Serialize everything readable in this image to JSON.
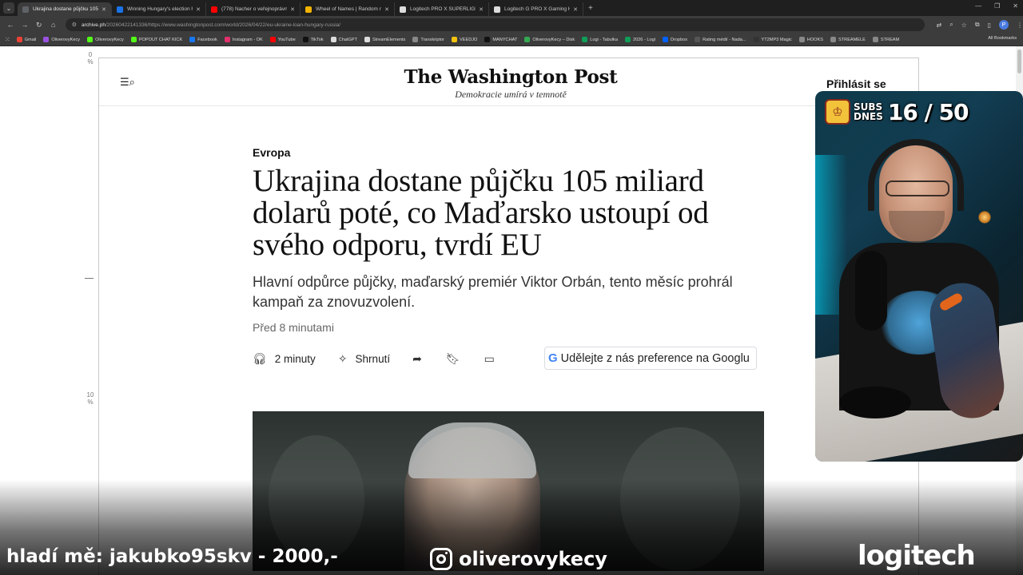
{
  "browser": {
    "tabs": [
      {
        "title": "Ukrajina dostane půjčku 105 mi",
        "color": "#5f6368",
        "active": true
      },
      {
        "title": "Winning Hungary's election ha",
        "color": "#1a73e8",
        "active": false
      },
      {
        "title": "(778) Nacher o veřejnoprávních",
        "color": "#ff0000",
        "active": false
      },
      {
        "title": "Wheel of Names | Random nam",
        "color": "#f4b400",
        "active": false
      },
      {
        "title": "Logitech PRO X SUPERLIGHT 2",
        "color": "#dddddd",
        "active": false
      },
      {
        "title": "Logitech G PRO X Gaming Hea",
        "color": "#dddddd",
        "active": false
      }
    ],
    "url_host": "archive.ph",
    "url_path": "/20260422141336/https://www.washingtonpost.com/world/2026/04/22/eu-ukraine-loan-hungary-russia/",
    "profile_initial": "P",
    "bookmarks": [
      {
        "label": "Gmail",
        "color": "#ea4335"
      },
      {
        "label": "OliverovyKecy",
        "color": "#9b51e0"
      },
      {
        "label": "OliverovyKecy",
        "color": "#53fc18"
      },
      {
        "label": "POPOUT CHAT KICK",
        "color": "#53fc18"
      },
      {
        "label": "Facebook",
        "color": "#1877f2"
      },
      {
        "label": "Instagram - OK",
        "color": "#e1306c"
      },
      {
        "label": "YouTube",
        "color": "#ff0000"
      },
      {
        "label": "TikTok",
        "color": "#111111"
      },
      {
        "label": "ChatGPT",
        "color": "#dddddd"
      },
      {
        "label": "StreamElements",
        "color": "#dddddd"
      },
      {
        "label": "Transkriptor",
        "color": "#888888"
      },
      {
        "label": "VEEDJO",
        "color": "#f4c20d"
      },
      {
        "label": "MANYCHAT",
        "color": "#111111"
      },
      {
        "label": "OliverovyKecy – Disk",
        "color": "#34a853"
      },
      {
        "label": "Logi - Tabulka",
        "color": "#0f9d58"
      },
      {
        "label": "2026 - Logi",
        "color": "#0f9d58"
      },
      {
        "label": "Dropbox",
        "color": "#0061ff"
      },
      {
        "label": "Rating médií - Nada...",
        "color": "#555555"
      },
      {
        "label": "YT2MP3 Magic",
        "color": "#333333"
      },
      {
        "label": "HOOKS",
        "color": "#888888"
      },
      {
        "label": "STREAMELE",
        "color": "#888888"
      },
      {
        "label": "STREAM",
        "color": "#888888"
      }
    ],
    "all_bookmarks": "All Bookmarks"
  },
  "ruler": {
    "top": "0 %",
    "bottom": "10 %"
  },
  "site": {
    "logo": "The Washington Post",
    "tagline": "Demokracie umírá v temnotě",
    "signin": "Přihlásit se"
  },
  "article": {
    "section": "Evropa",
    "headline": "Ukrajina dostane půjčku 105 miliard dolarů poté, co Maďarsko ustoupí od svého odporu, tvrdí EU",
    "dek": "Hlavní odpůrce půjčky, maďarský premiér Viktor Orbán, tento měsíc prohrál kampaň za znovuzvolení.",
    "timestamp": "Před 8 minutami",
    "listen_label": "2 minuty",
    "summary_label": "Shrnutí",
    "google_pref_label": "Udělejte z nás preference na Googlu"
  },
  "stream": {
    "subs_label_1": "SUBS",
    "subs_label_2": "DNES",
    "subs_count": "16 / 50",
    "ticker": "hladí mě: jakubko95skv - 2000,-",
    "instagram_handle": "oliverovykecy",
    "sponsor": "logitech"
  }
}
